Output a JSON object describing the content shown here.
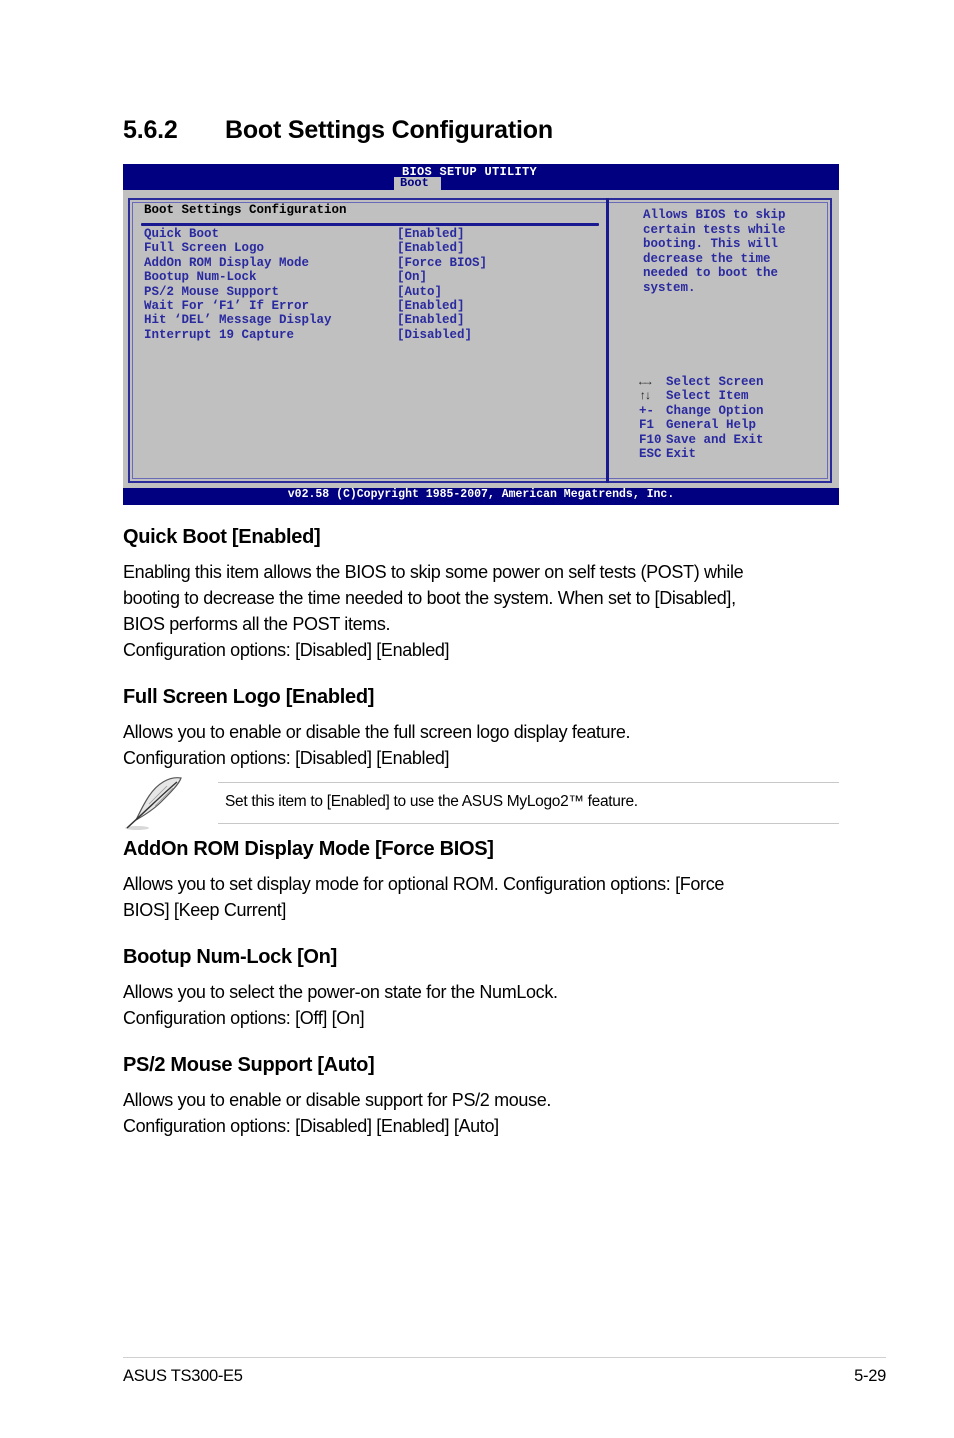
{
  "page": {
    "section_number": "5.6.2",
    "title": "Boot Settings Configuration"
  },
  "bios": {
    "utility_title": "BIOS SETUP UTILITY",
    "active_tab": "Boot",
    "section_title": "Boot Settings Configuration",
    "items": [
      {
        "label": "Quick Boot",
        "value": "[Enabled]"
      },
      {
        "label": "Full Screen Logo",
        "value": "[Enabled]"
      },
      {
        "label": "AddOn ROM Display Mode",
        "value": "[Force BIOS]"
      },
      {
        "label": "Bootup Num-Lock",
        "value": "[On]"
      },
      {
        "label": "PS/2 Mouse Support",
        "value": "[Auto]"
      },
      {
        "label": "Wait For ‘F1’ If Error",
        "value": "[Enabled]"
      },
      {
        "label": "Hit ‘DEL’ Message Display",
        "value": "[Enabled]"
      },
      {
        "label": "Interrupt 19 Capture",
        "value": "[Disabled]"
      }
    ],
    "help_text": "Allows BIOS to skip\ncertain tests while\nbooting. This will\ndecrease the time\nneeded to boot the\nsystem.",
    "keys": [
      {
        "key": "←→",
        "action": "Select Screen"
      },
      {
        "key": "↑↓",
        "action": "Select Item"
      },
      {
        "key": "+-",
        "action": "Change Option"
      },
      {
        "key": "F1",
        "action": "General Help"
      },
      {
        "key": "F10",
        "action": "Save and Exit"
      },
      {
        "key": "ESC",
        "action": "Exit"
      }
    ],
    "footer": "v02.58 (C)Copyright 1985-2007, American Megatrends, Inc."
  },
  "sections": [
    {
      "heading": "Quick Boot [Enabled]",
      "lines": [
        "Enabling this item allows the BIOS to skip some power on self tests (POST) while",
        "booting to decrease the time needed to boot the system. When set to [Disabled],",
        "BIOS performs all the POST items.",
        "Configuration options: [Disabled] [Enabled]"
      ]
    },
    {
      "heading": "Full Screen Logo [Enabled]",
      "lines": [
        "Allows you to enable or disable the full screen logo display feature.",
        "Configuration options: [Disabled] [Enabled]"
      ]
    },
    {
      "heading": "AddOn ROM Display Mode [Force BIOS]",
      "lines": [
        "Allows you to set display mode for optional ROM. Configuration options: [Force",
        "BIOS] [Keep Current]"
      ]
    },
    {
      "heading": "Bootup Num-Lock [On]",
      "lines": [
        "Allows you to select the power-on state for the NumLock.",
        "Configuration options: [Off] [On]"
      ]
    },
    {
      "heading": "PS/2 Mouse Support [Auto]",
      "lines": [
        "Allows you to enable or disable support for PS/2 mouse.",
        "Configuration options: [Disabled] [Enabled] [Auto]"
      ]
    }
  ],
  "note": {
    "icon": "feather-pen-icon",
    "text": "Set this item to [Enabled] to use the ASUS MyLogo2™ feature."
  },
  "footer": {
    "product": "ASUS TS300-E5",
    "page_number": "5-29"
  }
}
